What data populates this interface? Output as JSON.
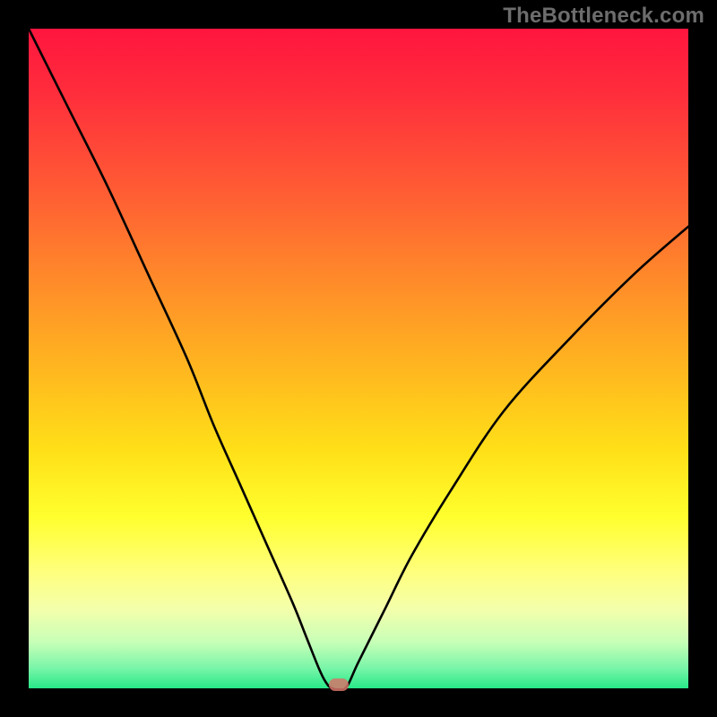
{
  "watermark": "TheBottleneck.com",
  "chart_data": {
    "type": "line",
    "title": "",
    "xlabel": "",
    "ylabel": "",
    "xlim": [
      0,
      100
    ],
    "ylim": [
      0,
      100
    ],
    "grid": false,
    "legend": false,
    "background_gradient": {
      "top": "#ff153e",
      "middle": "#ffe018",
      "bottom": "#27e888"
    },
    "series": [
      {
        "name": "bottleneck-curve",
        "type": "line",
        "color": "#000000",
        "x": [
          0,
          6,
          12,
          18,
          24,
          28,
          32,
          36,
          40,
          42,
          44,
          45,
          46,
          48,
          50,
          54,
          58,
          64,
          72,
          82,
          92,
          100
        ],
        "y": [
          100,
          88,
          76,
          63,
          50,
          40,
          31,
          22,
          13,
          8,
          3,
          1,
          0,
          0,
          4,
          12,
          20,
          30,
          42,
          53,
          63,
          70
        ]
      }
    ],
    "marker": {
      "x": 47,
      "y": 0.5,
      "color": "#d6746a"
    },
    "flat_segment": {
      "x_start": 44,
      "x_end": 48,
      "y": 0.5
    }
  }
}
